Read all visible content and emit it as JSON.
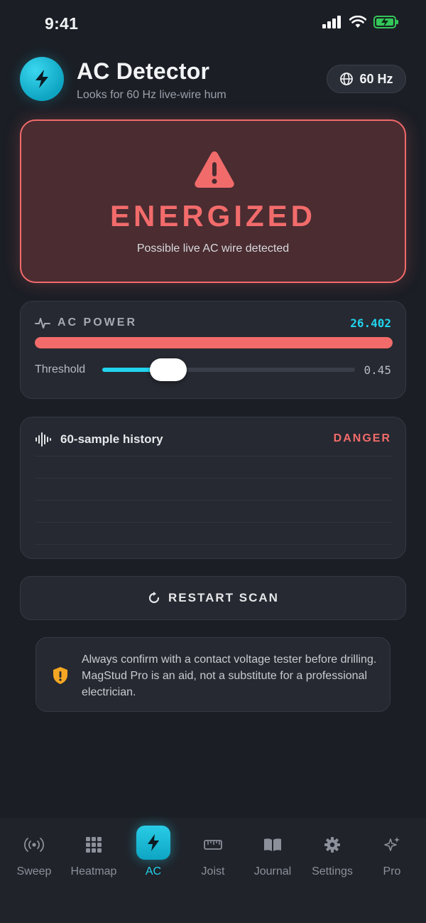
{
  "status_bar": {
    "time": "9:41"
  },
  "header": {
    "title": "AC Detector",
    "subtitle": "Looks for 60 Hz live-wire hum",
    "frequency_label": "60 Hz"
  },
  "alert": {
    "title": "ENERGIZED",
    "subtitle": "Possible live AC wire detected",
    "color": "#f26b6b"
  },
  "power": {
    "label": "AC POWER",
    "value": "26.402",
    "level_fraction": 1.0,
    "threshold_label": "Threshold",
    "threshold_value": "0.45",
    "threshold_fraction": 0.26
  },
  "history": {
    "label": "60-sample history",
    "status": "DANGER"
  },
  "restart": {
    "label": "RESTART SCAN"
  },
  "disclaimer": {
    "text": "Always confirm with a contact voltage tester before drilling. MagStud Pro is an aid, not a substitute for a professional electrician."
  },
  "tabs": [
    {
      "label": "Sweep",
      "icon": "radar-icon"
    },
    {
      "label": "Heatmap",
      "icon": "grid-icon"
    },
    {
      "label": "AC",
      "icon": "bolt-icon",
      "active": true
    },
    {
      "label": "Joist",
      "icon": "ruler-icon"
    },
    {
      "label": "Journal",
      "icon": "book-icon"
    },
    {
      "label": "Settings",
      "icon": "gear-icon"
    },
    {
      "label": "Pro",
      "icon": "sparkle-icon"
    }
  ],
  "colors": {
    "accent": "#22d3ee",
    "danger": "#f26b6b",
    "background": "#1b1e25"
  }
}
